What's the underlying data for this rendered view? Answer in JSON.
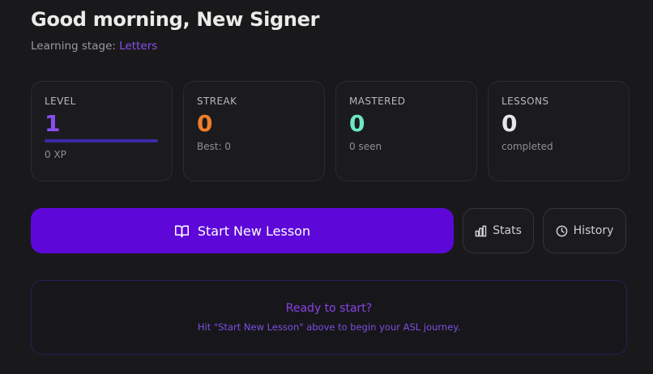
{
  "header": {
    "greeting": "Good morning, New Signer",
    "stage_label": "Learning stage:",
    "stage_value": "Letters"
  },
  "stats": {
    "level": {
      "label": "LEVEL",
      "value": "1",
      "sub": "0 XP",
      "progress": 0,
      "color": "#8a4ff0"
    },
    "streak": {
      "label": "STREAK",
      "value": "0",
      "sub": "Best: 0",
      "color": "#f07f2a"
    },
    "mastered": {
      "label": "MASTERED",
      "value": "0",
      "sub": "0 seen",
      "color": "#6ee7c4"
    },
    "lessons": {
      "label": "LESSONS",
      "value": "0",
      "sub": "completed",
      "color": "#e6e6e8"
    }
  },
  "actions": {
    "start_label": "Start New Lesson",
    "start_icon": "book-open-icon",
    "stats_label": "Stats",
    "stats_icon": "bar-chart-icon",
    "history_label": "History",
    "history_icon": "clock-icon"
  },
  "empty_state": {
    "title": "Ready to start?",
    "subtitle": "Hit \"Start New Lesson\" above to begin your ASL journey."
  },
  "colors": {
    "background": "#19191b",
    "accent": "#5d08d8",
    "accent_text": "#8a4ff0"
  }
}
